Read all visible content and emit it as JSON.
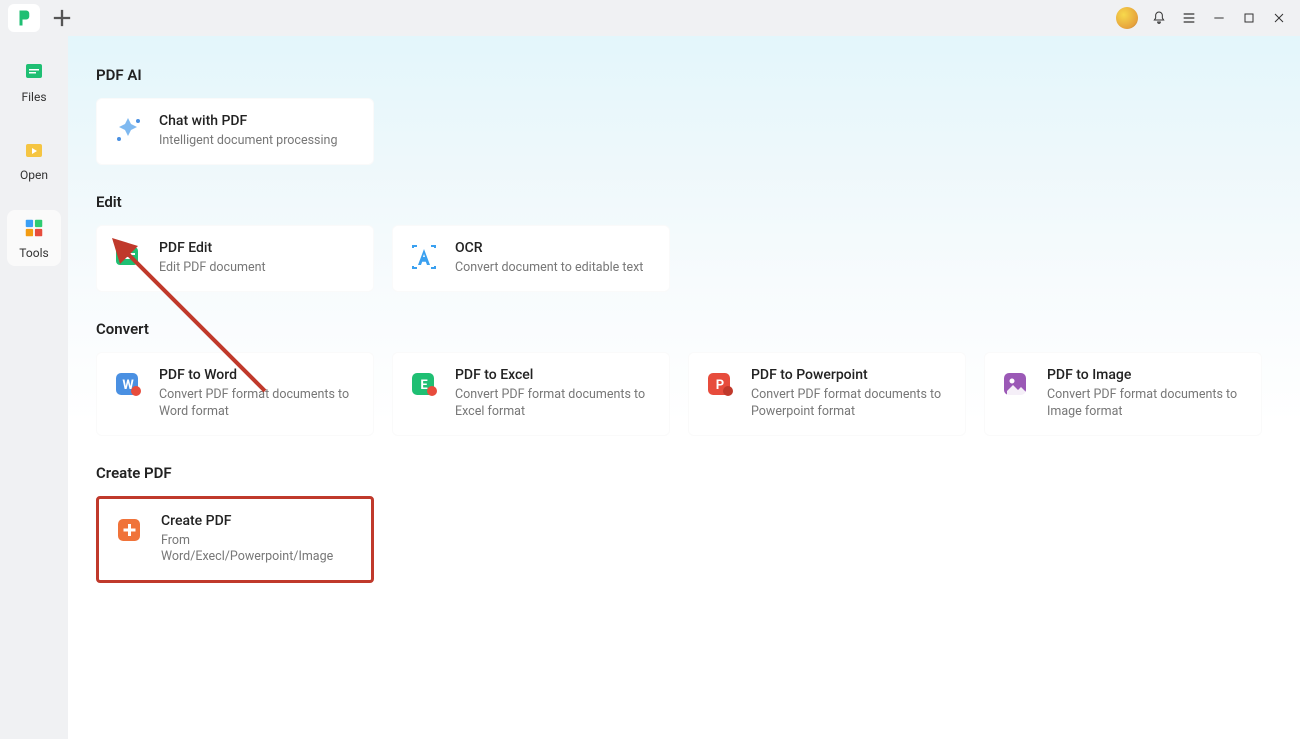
{
  "sidebar": {
    "items": [
      {
        "label": "Files"
      },
      {
        "label": "Open"
      },
      {
        "label": "Tools"
      }
    ]
  },
  "sections": {
    "pdf_ai": {
      "title": "PDF AI",
      "chat": {
        "title": "Chat with PDF",
        "desc": "Intelligent document processing"
      }
    },
    "edit": {
      "title": "Edit",
      "pdf_edit": {
        "title": "PDF Edit",
        "desc": "Edit PDF document"
      },
      "ocr": {
        "title": "OCR",
        "desc": "Convert document to editable text"
      }
    },
    "convert": {
      "title": "Convert",
      "word": {
        "title": "PDF to Word",
        "desc": "Convert PDF format documents to Word format"
      },
      "excel": {
        "title": "PDF to Excel",
        "desc": "Convert PDF format documents to Excel format"
      },
      "ppt": {
        "title": "PDF to Powerpoint",
        "desc": "Convert PDF format documents to Powerpoint format"
      },
      "image": {
        "title": "PDF to Image",
        "desc": "Convert PDF format documents to Image format"
      }
    },
    "create": {
      "title": "Create PDF",
      "create": {
        "title": "Create PDF",
        "desc": "From Word/Execl/Powerpoint/Image"
      }
    }
  }
}
